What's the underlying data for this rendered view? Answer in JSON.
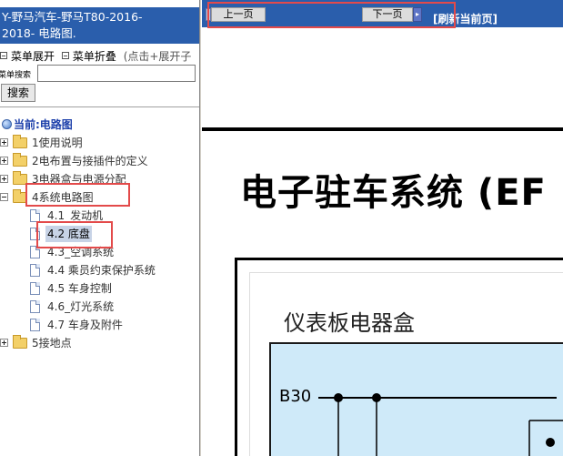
{
  "left_panel": {
    "title_line1": "Y-野马汽车-野马T80-2016-",
    "title_line2": "2018- 电路图.",
    "menu_expand": "菜单展开",
    "menu_collapse": "菜单折叠",
    "menu_hint": "(点击+展开子",
    "search_label": "菜单搜索",
    "search_value": "",
    "search_button": "搜索",
    "tree": {
      "current": "当前:电路图",
      "items": [
        {
          "label": "1使用说明"
        },
        {
          "label": "2电布置与接插件的定义"
        },
        {
          "label": "3电器盒与电源分配"
        },
        {
          "label": "4系统电路图"
        },
        {
          "label": "5接地点"
        }
      ],
      "children": [
        {
          "label": "4.1_发动机"
        },
        {
          "label": "4.2 底盘"
        },
        {
          "label": "4.3_空调系统"
        },
        {
          "label": "4.4 乘员约束保护系统"
        },
        {
          "label": "4.5 车身控制"
        },
        {
          "label": "4.6_灯光系统"
        },
        {
          "label": "4.7 车身及附件"
        }
      ]
    }
  },
  "right_panel": {
    "prev_button": "上一页",
    "next_button": "下一页",
    "refresh_button": "[刷新当前页]",
    "doc_title": "电子驻车系统 (EF",
    "box_title": "仪表板电器盒",
    "wire_label": "B30"
  },
  "colors": {
    "header_blue": "#2a5eac",
    "annotation_red": "#e34a4a",
    "selection_bg": "#c7d3e6",
    "diagram_fill": "#cfeaf9"
  }
}
